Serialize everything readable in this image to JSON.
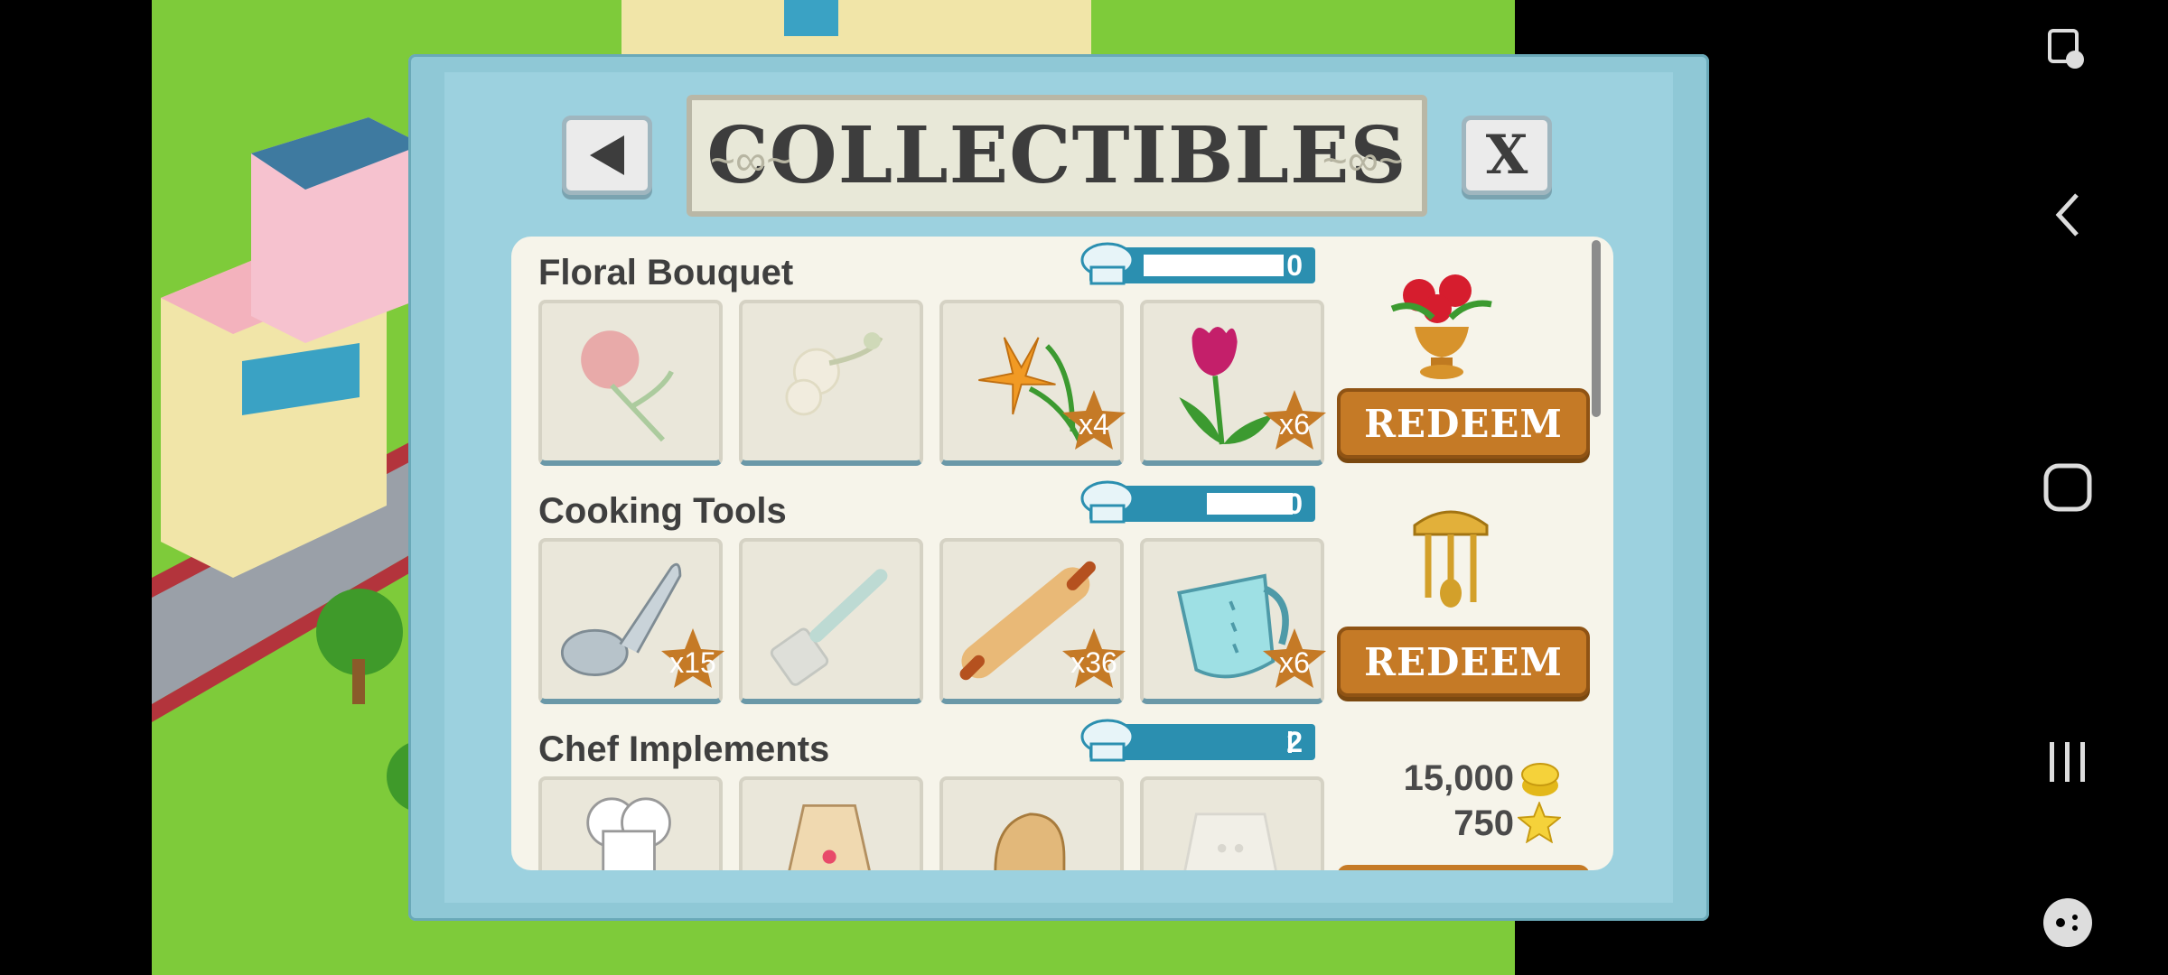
{
  "dialog": {
    "title": "COLLECTIBLES",
    "back_icon": "back-arrow-icon",
    "close_label": "X"
  },
  "sections": [
    {
      "title": "Floral Bouquet",
      "progress": "0",
      "redeem_label": "REDEEM",
      "reward_icon": "flower-vase-icon",
      "items": [
        {
          "name": "rose-icon",
          "count": "",
          "collected": false
        },
        {
          "name": "orchid-icon",
          "count": "",
          "collected": false
        },
        {
          "name": "lily-icon",
          "count": "x4",
          "collected": true
        },
        {
          "name": "tulip-icon",
          "count": "x6",
          "collected": true
        }
      ]
    },
    {
      "title": "Cooking Tools",
      "progress": "0",
      "redeem_label": "REDEEM",
      "reward_icon": "utensil-rack-icon",
      "items": [
        {
          "name": "ladle-icon",
          "count": "x15",
          "collected": true
        },
        {
          "name": "spatula-icon",
          "count": "",
          "collected": false
        },
        {
          "name": "rolling-pin-icon",
          "count": "x36",
          "collected": true
        },
        {
          "name": "measuring-cup-icon",
          "count": "x6",
          "collected": true
        }
      ]
    },
    {
      "title": "Chef Implements",
      "progress": "2",
      "coins": "15,000",
      "stars": "750",
      "items": [
        {
          "name": "chef-hat-icon",
          "count": "",
          "collected": true
        },
        {
          "name": "apron-icon",
          "count": "",
          "collected": true
        },
        {
          "name": "oven-mitt-icon",
          "count": "",
          "collected": true
        },
        {
          "name": "chef-jacket-icon",
          "count": "",
          "collected": false
        }
      ]
    }
  ],
  "colors": {
    "redeem": "#c57a26",
    "frame": "#8fc8d6",
    "progress": "#2b8fb0"
  }
}
